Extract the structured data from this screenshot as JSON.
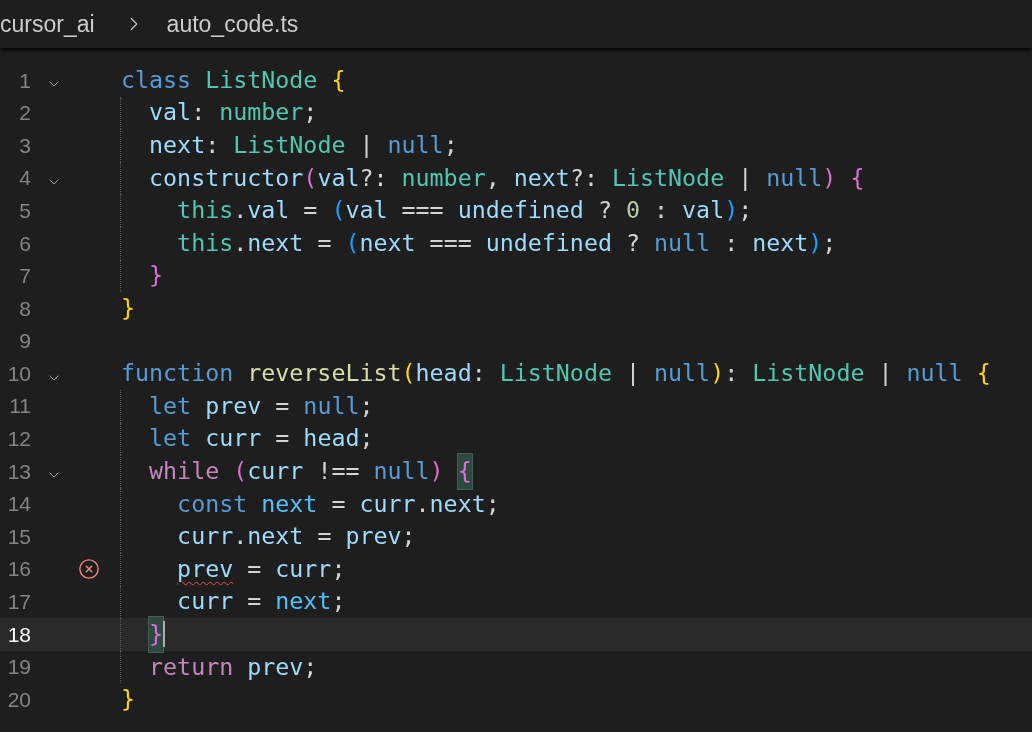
{
  "breadcrumb": [
    {
      "label": "cursor_ai"
    },
    {
      "label": "auto_code.ts"
    }
  ],
  "lines": [
    {
      "number": "1",
      "foldable": true,
      "error": false,
      "active": false,
      "tokens": [
        {
          "kind": "keyword",
          "text": "class ",
          "matched": false
        },
        {
          "kind": "type",
          "text": "ListNode ",
          "matched": false
        },
        {
          "kind": "bracket1",
          "text": "{",
          "matched": false
        }
      ]
    },
    {
      "number": "2",
      "foldable": false,
      "error": false,
      "active": false,
      "tokens": [
        {
          "kind": "variable",
          "text": "  val",
          "matched": false
        },
        {
          "kind": "plain",
          "text": ": ",
          "matched": false
        },
        {
          "kind": "type",
          "text": "number",
          "matched": false
        },
        {
          "kind": "plain",
          "text": ";",
          "matched": false
        }
      ]
    },
    {
      "number": "3",
      "foldable": false,
      "error": false,
      "active": false,
      "tokens": [
        {
          "kind": "variable",
          "text": "  next",
          "matched": false
        },
        {
          "kind": "plain",
          "text": ": ",
          "matched": false
        },
        {
          "kind": "type",
          "text": "ListNode",
          "matched": false
        },
        {
          "kind": "plain",
          "text": " | ",
          "matched": false
        },
        {
          "kind": "keyword",
          "text": "null",
          "matched": false
        },
        {
          "kind": "plain",
          "text": ";",
          "matched": false
        }
      ]
    },
    {
      "number": "4",
      "foldable": true,
      "error": false,
      "active": false,
      "tokens": [
        {
          "kind": "variable",
          "text": "  constructor",
          "matched": false
        },
        {
          "kind": "bracket2",
          "text": "(",
          "matched": false
        },
        {
          "kind": "variable",
          "text": "val",
          "matched": false
        },
        {
          "kind": "plain",
          "text": "?: ",
          "matched": false
        },
        {
          "kind": "type",
          "text": "number",
          "matched": false
        },
        {
          "kind": "plain",
          "text": ", ",
          "matched": false
        },
        {
          "kind": "variable",
          "text": "next",
          "matched": false
        },
        {
          "kind": "plain",
          "text": "?: ",
          "matched": false
        },
        {
          "kind": "type",
          "text": "ListNode",
          "matched": false
        },
        {
          "kind": "plain",
          "text": " | ",
          "matched": false
        },
        {
          "kind": "keyword",
          "text": "null",
          "matched": false
        },
        {
          "kind": "bracket2",
          "text": ") ",
          "matched": false
        },
        {
          "kind": "bracket2",
          "text": "{",
          "matched": false
        }
      ]
    },
    {
      "number": "5",
      "foldable": false,
      "error": false,
      "active": false,
      "tokens": [
        {
          "kind": "type",
          "text": "    this",
          "matched": false
        },
        {
          "kind": "plain",
          "text": ".",
          "matched": false
        },
        {
          "kind": "variable",
          "text": "val",
          "matched": false
        },
        {
          "kind": "plain",
          "text": " = ",
          "matched": false
        },
        {
          "kind": "bracket3",
          "text": "(",
          "matched": false
        },
        {
          "kind": "variable",
          "text": "val",
          "matched": false
        },
        {
          "kind": "plain",
          "text": " === ",
          "matched": false
        },
        {
          "kind": "variable",
          "text": "undefined",
          "matched": false
        },
        {
          "kind": "plain",
          "text": " ? ",
          "matched": false
        },
        {
          "kind": "number",
          "text": "0",
          "matched": false
        },
        {
          "kind": "plain",
          "text": " : ",
          "matched": false
        },
        {
          "kind": "variable",
          "text": "val",
          "matched": false
        },
        {
          "kind": "bracket3",
          "text": ")",
          "matched": false
        },
        {
          "kind": "plain",
          "text": ";",
          "matched": false
        }
      ]
    },
    {
      "number": "6",
      "foldable": false,
      "error": false,
      "active": false,
      "tokens": [
        {
          "kind": "type",
          "text": "    this",
          "matched": false
        },
        {
          "kind": "plain",
          "text": ".",
          "matched": false
        },
        {
          "kind": "variable",
          "text": "next",
          "matched": false
        },
        {
          "kind": "plain",
          "text": " = ",
          "matched": false
        },
        {
          "kind": "bracket3",
          "text": "(",
          "matched": false
        },
        {
          "kind": "variable",
          "text": "next",
          "matched": false
        },
        {
          "kind": "plain",
          "text": " === ",
          "matched": false
        },
        {
          "kind": "variable",
          "text": "undefined",
          "matched": false
        },
        {
          "kind": "plain",
          "text": " ? ",
          "matched": false
        },
        {
          "kind": "keyword",
          "text": "null",
          "matched": false
        },
        {
          "kind": "plain",
          "text": " : ",
          "matched": false
        },
        {
          "kind": "variable",
          "text": "next",
          "matched": false
        },
        {
          "kind": "bracket3",
          "text": ")",
          "matched": false
        },
        {
          "kind": "plain",
          "text": ";",
          "matched": false
        }
      ]
    },
    {
      "number": "7",
      "foldable": false,
      "error": false,
      "active": false,
      "tokens": [
        {
          "kind": "bracket2",
          "text": "  }",
          "matched": false
        }
      ]
    },
    {
      "number": "8",
      "foldable": false,
      "error": false,
      "active": false,
      "tokens": [
        {
          "kind": "bracket1",
          "text": "}",
          "matched": false
        }
      ]
    },
    {
      "number": "9",
      "foldable": false,
      "error": false,
      "active": false
    },
    {
      "number": "10",
      "foldable": true,
      "error": false,
      "active": false,
      "tokens": [
        {
          "kind": "keyword",
          "text": "function ",
          "matched": false
        },
        {
          "kind": "function",
          "text": "reverseList",
          "matched": false
        },
        {
          "kind": "bracket1",
          "text": "(",
          "matched": false
        },
        {
          "kind": "variable",
          "text": "head",
          "matched": false
        },
        {
          "kind": "plain",
          "text": ": ",
          "matched": false
        },
        {
          "kind": "type",
          "text": "ListNode",
          "matched": false
        },
        {
          "kind": "plain",
          "text": " | ",
          "matched": false
        },
        {
          "kind": "keyword",
          "text": "null",
          "matched": false
        },
        {
          "kind": "bracket1",
          "text": ")",
          "matched": false
        },
        {
          "kind": "plain",
          "text": ": ",
          "matched": false
        },
        {
          "kind": "type",
          "text": "ListNode",
          "matched": false
        },
        {
          "kind": "plain",
          "text": " | ",
          "matched": false
        },
        {
          "kind": "keyword",
          "text": "null ",
          "matched": false
        },
        {
          "kind": "bracket1",
          "text": "{",
          "matched": false
        }
      ]
    },
    {
      "number": "11",
      "foldable": false,
      "error": false,
      "active": false,
      "tokens": [
        {
          "kind": "keyword",
          "text": "  let ",
          "matched": false
        },
        {
          "kind": "variable",
          "text": "prev",
          "matched": false
        },
        {
          "kind": "plain",
          "text": " = ",
          "matched": false
        },
        {
          "kind": "keyword",
          "text": "null",
          "matched": false
        },
        {
          "kind": "plain",
          "text": ";",
          "matched": false
        }
      ]
    },
    {
      "number": "12",
      "foldable": false,
      "error": false,
      "active": false,
      "tokens": [
        {
          "kind": "keyword",
          "text": "  let ",
          "matched": false
        },
        {
          "kind": "variable",
          "text": "curr",
          "matched": false
        },
        {
          "kind": "plain",
          "text": " = ",
          "matched": false
        },
        {
          "kind": "variable",
          "text": "head",
          "matched": false
        },
        {
          "kind": "plain",
          "text": ";",
          "matched": false
        }
      ]
    },
    {
      "number": "13",
      "foldable": true,
      "error": false,
      "active": false,
      "tokens": [
        {
          "kind": "control",
          "text": "  while ",
          "matched": false
        },
        {
          "kind": "bracket2",
          "text": "(",
          "matched": false
        },
        {
          "kind": "variable",
          "text": "curr",
          "matched": false
        },
        {
          "kind": "plain",
          "text": " !== ",
          "matched": false
        },
        {
          "kind": "keyword",
          "text": "null",
          "matched": false
        },
        {
          "kind": "bracket2",
          "text": ") ",
          "matched": false
        },
        {
          "kind": "bracket2",
          "text": "{",
          "matched": true
        }
      ]
    },
    {
      "number": "14",
      "foldable": false,
      "error": false,
      "active": false,
      "tokens": [
        {
          "kind": "keyword",
          "text": "    const ",
          "matched": false
        },
        {
          "kind": "constant",
          "text": "next",
          "matched": false
        },
        {
          "kind": "plain",
          "text": " = ",
          "matched": false
        },
        {
          "kind": "variable",
          "text": "curr",
          "matched": false
        },
        {
          "kind": "plain",
          "text": ".",
          "matched": false
        },
        {
          "kind": "variable",
          "text": "next",
          "matched": false
        },
        {
          "kind": "plain",
          "text": ";",
          "matched": false
        }
      ]
    },
    {
      "number": "15",
      "foldable": false,
      "error": false,
      "active": false,
      "tokens": [
        {
          "kind": "variable",
          "text": "    curr",
          "matched": false
        },
        {
          "kind": "plain",
          "text": ".",
          "matched": false
        },
        {
          "kind": "variable",
          "text": "next",
          "matched": false
        },
        {
          "kind": "plain",
          "text": " = ",
          "matched": false
        },
        {
          "kind": "variable",
          "text": "prev",
          "matched": false
        },
        {
          "kind": "plain",
          "text": ";",
          "matched": false
        }
      ]
    },
    {
      "number": "16",
      "foldable": false,
      "error": true,
      "active": false,
      "tokens": [
        {
          "kind": "variable",
          "text": "    prev",
          "matched": false
        },
        {
          "kind": "plain",
          "text": " = ",
          "matched": false
        },
        {
          "kind": "variable",
          "text": "curr",
          "matched": false
        },
        {
          "kind": "plain",
          "text": ";",
          "matched": false
        }
      ]
    },
    {
      "number": "17",
      "foldable": false,
      "error": false,
      "active": false,
      "tokens": [
        {
          "kind": "variable",
          "text": "    curr",
          "matched": false
        },
        {
          "kind": "plain",
          "text": " = ",
          "matched": false
        },
        {
          "kind": "constant",
          "text": "next",
          "matched": false
        },
        {
          "kind": "plain",
          "text": ";",
          "matched": false
        }
      ]
    },
    {
      "number": "18",
      "foldable": false,
      "error": false,
      "active": true,
      "tokens": [
        {
          "kind": "bracket2",
          "text": "  }",
          "matched": true
        }
      ]
    },
    {
      "number": "19",
      "foldable": false,
      "error": false,
      "active": false,
      "tokens": [
        {
          "kind": "control",
          "text": "  return ",
          "matched": false
        },
        {
          "kind": "variable",
          "text": "prev",
          "matched": false
        },
        {
          "kind": "plain",
          "text": ";",
          "matched": false
        }
      ]
    },
    {
      "number": "20",
      "foldable": false,
      "error": false,
      "active": false,
      "tokens": [
        {
          "kind": "bracket1",
          "text": "}",
          "matched": false
        }
      ]
    }
  ]
}
